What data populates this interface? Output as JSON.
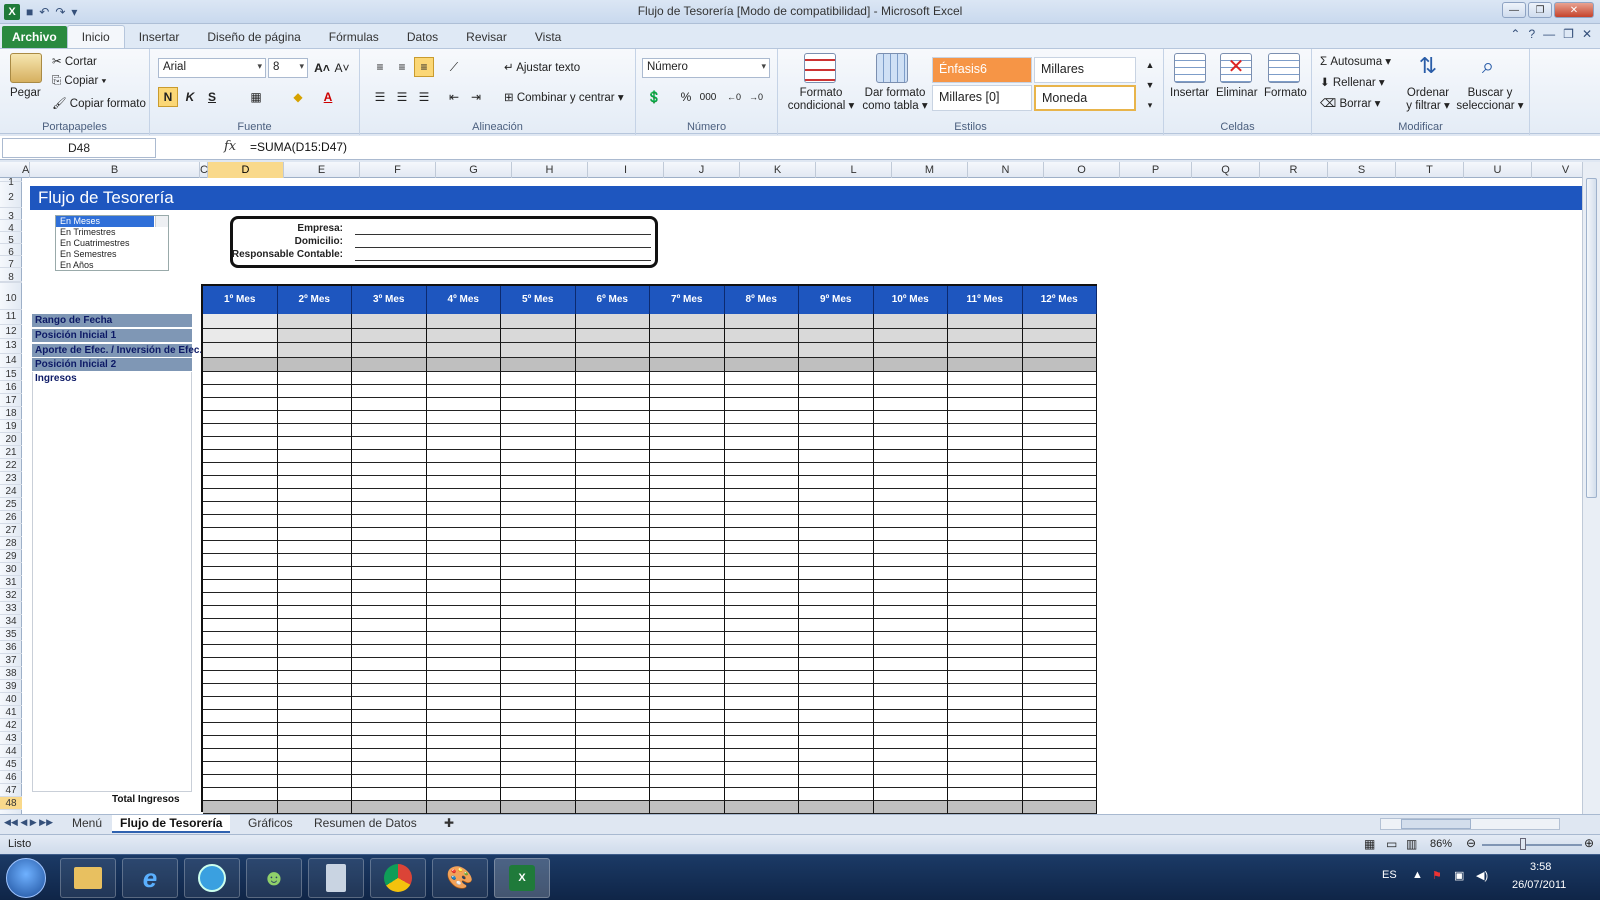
{
  "window": {
    "title": "Flujo de Tesorería  [Modo de compatibilidad]  -  Microsoft Excel",
    "app_icon": "X"
  },
  "ribbon_tabs": [
    "Archivo",
    "Inicio",
    "Insertar",
    "Diseño de página",
    "Fórmulas",
    "Datos",
    "Revisar",
    "Vista"
  ],
  "ribbon": {
    "portapapeles": {
      "paste": "Pegar",
      "cut": "Cortar",
      "copy": "Copiar",
      "format_painter": "Copiar formato",
      "label": "Portapapeles"
    },
    "fuente": {
      "font": "Arial",
      "size": "8",
      "bold": "N",
      "italic": "K",
      "underline": "S",
      "label": "Fuente"
    },
    "alineacion": {
      "wrap": "Ajustar texto",
      "merge": "Combinar y centrar",
      "label": "Alineación"
    },
    "numero": {
      "format": "Número",
      "percent": "%",
      "thousands": "000",
      "label": "Número"
    },
    "estilos": {
      "cond_format_1": "Formato",
      "cond_format_2": "condicional",
      "table_format_1": "Dar formato",
      "table_format_2": "como tabla",
      "style1": "Énfasis6",
      "style2": "Millares",
      "style3": "Millares [0]",
      "style4": "Moneda",
      "label": "Estilos"
    },
    "celdas": {
      "insert": "Insertar",
      "delete": "Eliminar",
      "format": "Formato",
      "label": "Celdas"
    },
    "modificar": {
      "autosum": "Autosuma",
      "fill": "Rellenar",
      "clear": "Borrar",
      "sort_1": "Ordenar",
      "sort_2": "y filtrar",
      "find_1": "Buscar y",
      "find_2": "seleccionar",
      "label": "Modificar"
    }
  },
  "formula_bar": {
    "name_box": "D48",
    "fx": "fx",
    "formula": "=SUMA(D15:D47)"
  },
  "columns": [
    "A",
    "B",
    "C",
    "D",
    "E",
    "F",
    "G",
    "H",
    "I",
    "J",
    "K",
    "L",
    "M",
    "N",
    "O",
    "P",
    "Q",
    "R",
    "S",
    "T",
    "U",
    "V"
  ],
  "sheet": {
    "title": "Flujo de Tesorería",
    "listbox_items": [
      "En Meses",
      "En Trimestres",
      "En Cuatrimestres",
      "En Semestres",
      "En Años"
    ],
    "info_labels": [
      "Empresa:",
      "Domicilio:",
      "Responsable Contable:"
    ],
    "months": [
      "1º Mes",
      "2º Mes",
      "3º Mes",
      "4º Mes",
      "5º Mes",
      "6º Mes",
      "7º Mes",
      "8º Mes",
      "9º Mes",
      "10º Mes",
      "11º Mes",
      "12º Mes"
    ],
    "row_labels": [
      "Rango de Fecha",
      "Posición Inicial 1",
      "Aporte de Efec. / Inversión de Efec.",
      "Posición Inicial 2"
    ],
    "ingresos": "Ingresos",
    "total": "Total Ingresos"
  },
  "sheet_tabs": [
    "Menú",
    "Flujo de Tesorería",
    "Gráficos",
    "Resumen de Datos"
  ],
  "status": {
    "ready": "Listo",
    "zoom": "86%"
  },
  "taskbar": {
    "lang": "ES",
    "time": "3:58",
    "date": "26/07/2011"
  },
  "colors": {
    "header_blue": "#1e56bf",
    "label_fill": "#7f97b5",
    "excel_green": "#2a8a3f"
  }
}
